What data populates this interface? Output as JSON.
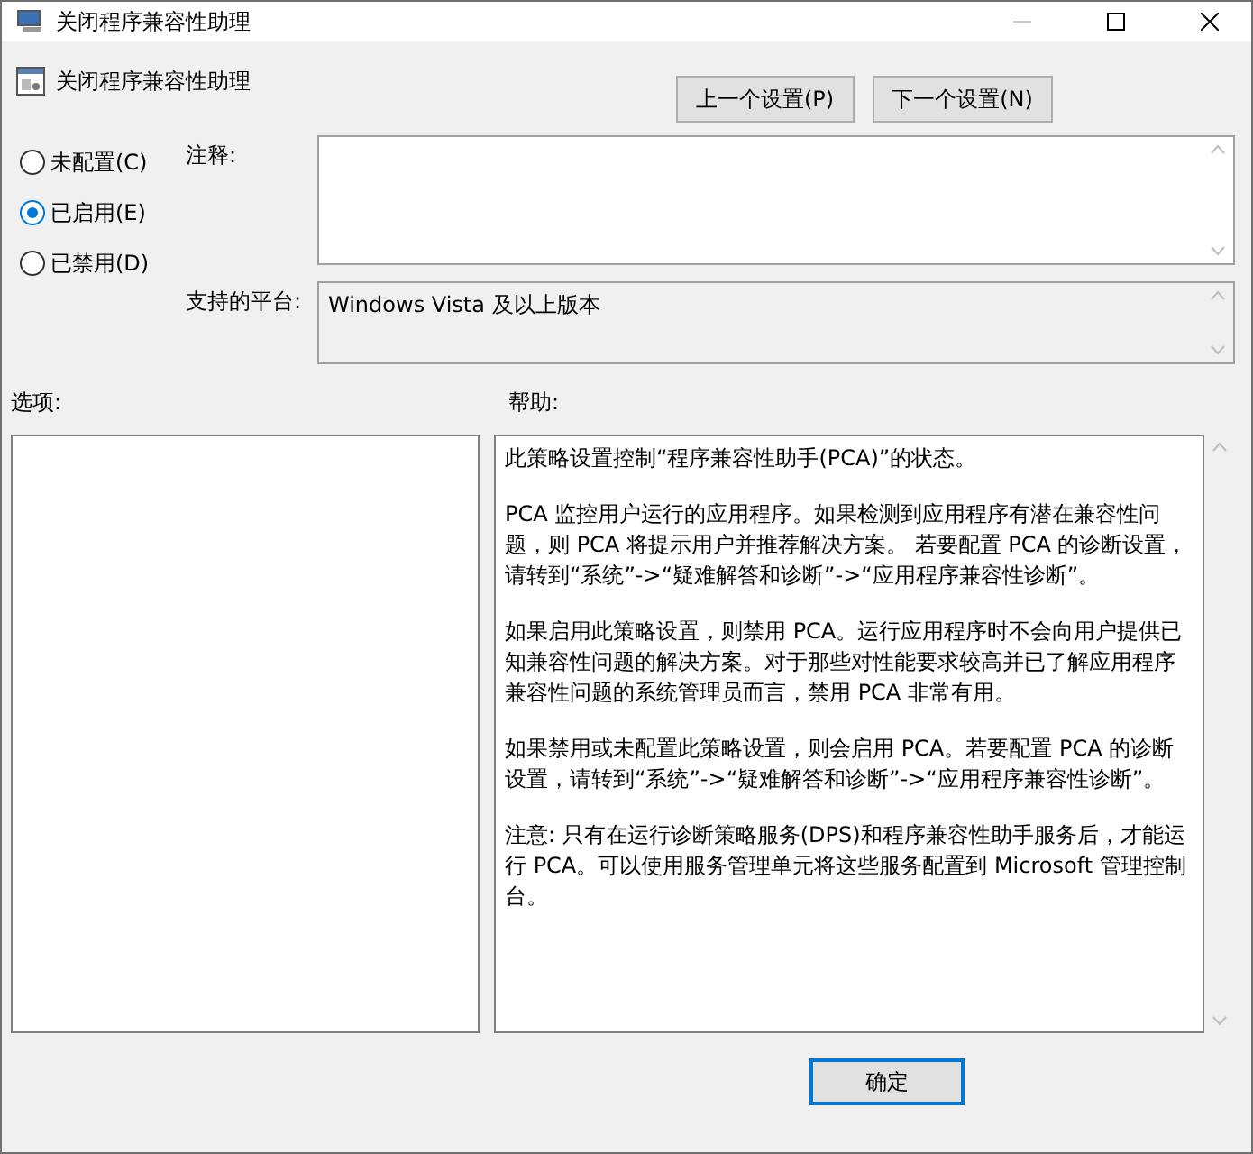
{
  "window": {
    "title": "关闭程序兼容性助理"
  },
  "header": {
    "title": "关闭程序兼容性助理",
    "buttons": [
      "上一个设置(P)",
      "下一个设置(N)"
    ]
  },
  "options": [
    {
      "label": "未配置(C)",
      "selected": false
    },
    {
      "label": "已启用(E)",
      "selected": true
    },
    {
      "label": "已禁用(D)",
      "selected": false
    }
  ],
  "comment": {
    "label": "注释:"
  },
  "platform": {
    "label": "支持的平台:",
    "value": "Windows Vista 及以上版本"
  },
  "options_panel": {
    "label": "选项:"
  },
  "help": {
    "label": "帮助:",
    "paragraphs": [
      "此策略设置控制“程序兼容性助手(PCA)”的状态。",
      "PCA 监控用户运行的应用程序。如果检测到应用程序有潜在兼容性问题，则 PCA 将提示用户并推荐解决方案。 若要配置 PCA 的诊断设置，请转到“系统”->“疑难解答和诊断”->“应用程序兼容性诊断”。",
      "如果启用此策略设置，则禁用 PCA。运行应用程序时不会向用户提供已知兼容性问题的解决方案。对于那些对性能要求较高并已了解应用程序兼容性问题的系统管理员而言，禁用 PCA 非常有用。",
      "如果禁用或未配置此策略设置，则会启用 PCA。若要配置 PCA 的诊断设置，请转到“系统”->“疑难解答和诊断”->“应用程序兼容性诊断”。",
      "注意: 只有在运行诊断策略服务(DPS)和程序兼容性助手服务后，才能运行 PCA。可以使用服务管理单元将这些服务配置到 Microsoft 管理控制台。"
    ]
  },
  "footer": {
    "buttons": [
      "确定"
    ]
  }
}
